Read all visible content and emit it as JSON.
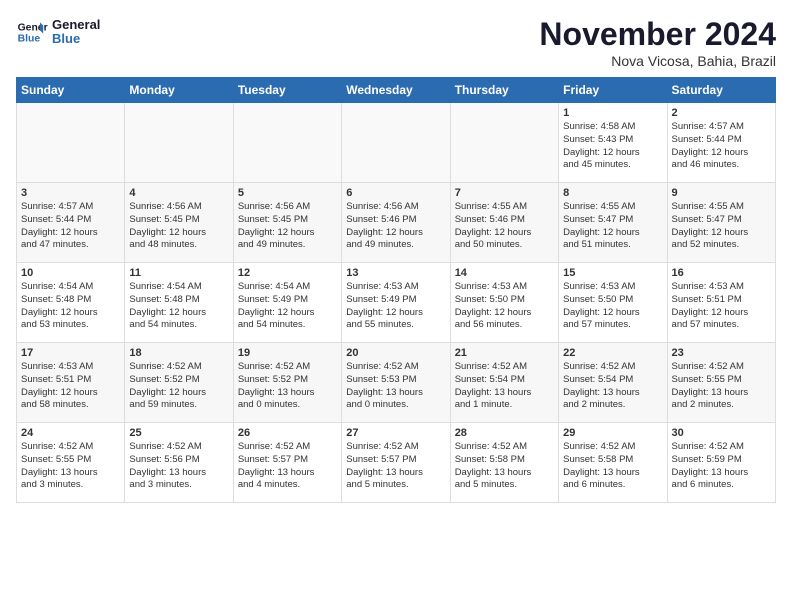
{
  "logo": {
    "line1": "General",
    "line2": "Blue"
  },
  "title": "November 2024",
  "location": "Nova Vicosa, Bahia, Brazil",
  "days_of_week": [
    "Sunday",
    "Monday",
    "Tuesday",
    "Wednesday",
    "Thursday",
    "Friday",
    "Saturday"
  ],
  "weeks": [
    [
      {
        "day": "",
        "info": ""
      },
      {
        "day": "",
        "info": ""
      },
      {
        "day": "",
        "info": ""
      },
      {
        "day": "",
        "info": ""
      },
      {
        "day": "",
        "info": ""
      },
      {
        "day": "1",
        "info": "Sunrise: 4:58 AM\nSunset: 5:43 PM\nDaylight: 12 hours\nand 45 minutes."
      },
      {
        "day": "2",
        "info": "Sunrise: 4:57 AM\nSunset: 5:44 PM\nDaylight: 12 hours\nand 46 minutes."
      }
    ],
    [
      {
        "day": "3",
        "info": "Sunrise: 4:57 AM\nSunset: 5:44 PM\nDaylight: 12 hours\nand 47 minutes."
      },
      {
        "day": "4",
        "info": "Sunrise: 4:56 AM\nSunset: 5:45 PM\nDaylight: 12 hours\nand 48 minutes."
      },
      {
        "day": "5",
        "info": "Sunrise: 4:56 AM\nSunset: 5:45 PM\nDaylight: 12 hours\nand 49 minutes."
      },
      {
        "day": "6",
        "info": "Sunrise: 4:56 AM\nSunset: 5:46 PM\nDaylight: 12 hours\nand 49 minutes."
      },
      {
        "day": "7",
        "info": "Sunrise: 4:55 AM\nSunset: 5:46 PM\nDaylight: 12 hours\nand 50 minutes."
      },
      {
        "day": "8",
        "info": "Sunrise: 4:55 AM\nSunset: 5:47 PM\nDaylight: 12 hours\nand 51 minutes."
      },
      {
        "day": "9",
        "info": "Sunrise: 4:55 AM\nSunset: 5:47 PM\nDaylight: 12 hours\nand 52 minutes."
      }
    ],
    [
      {
        "day": "10",
        "info": "Sunrise: 4:54 AM\nSunset: 5:48 PM\nDaylight: 12 hours\nand 53 minutes."
      },
      {
        "day": "11",
        "info": "Sunrise: 4:54 AM\nSunset: 5:48 PM\nDaylight: 12 hours\nand 54 minutes."
      },
      {
        "day": "12",
        "info": "Sunrise: 4:54 AM\nSunset: 5:49 PM\nDaylight: 12 hours\nand 54 minutes."
      },
      {
        "day": "13",
        "info": "Sunrise: 4:53 AM\nSunset: 5:49 PM\nDaylight: 12 hours\nand 55 minutes."
      },
      {
        "day": "14",
        "info": "Sunrise: 4:53 AM\nSunset: 5:50 PM\nDaylight: 12 hours\nand 56 minutes."
      },
      {
        "day": "15",
        "info": "Sunrise: 4:53 AM\nSunset: 5:50 PM\nDaylight: 12 hours\nand 57 minutes."
      },
      {
        "day": "16",
        "info": "Sunrise: 4:53 AM\nSunset: 5:51 PM\nDaylight: 12 hours\nand 57 minutes."
      }
    ],
    [
      {
        "day": "17",
        "info": "Sunrise: 4:53 AM\nSunset: 5:51 PM\nDaylight: 12 hours\nand 58 minutes."
      },
      {
        "day": "18",
        "info": "Sunrise: 4:52 AM\nSunset: 5:52 PM\nDaylight: 12 hours\nand 59 minutes."
      },
      {
        "day": "19",
        "info": "Sunrise: 4:52 AM\nSunset: 5:52 PM\nDaylight: 13 hours\nand 0 minutes."
      },
      {
        "day": "20",
        "info": "Sunrise: 4:52 AM\nSunset: 5:53 PM\nDaylight: 13 hours\nand 0 minutes."
      },
      {
        "day": "21",
        "info": "Sunrise: 4:52 AM\nSunset: 5:54 PM\nDaylight: 13 hours\nand 1 minute."
      },
      {
        "day": "22",
        "info": "Sunrise: 4:52 AM\nSunset: 5:54 PM\nDaylight: 13 hours\nand 2 minutes."
      },
      {
        "day": "23",
        "info": "Sunrise: 4:52 AM\nSunset: 5:55 PM\nDaylight: 13 hours\nand 2 minutes."
      }
    ],
    [
      {
        "day": "24",
        "info": "Sunrise: 4:52 AM\nSunset: 5:55 PM\nDaylight: 13 hours\nand 3 minutes."
      },
      {
        "day": "25",
        "info": "Sunrise: 4:52 AM\nSunset: 5:56 PM\nDaylight: 13 hours\nand 3 minutes."
      },
      {
        "day": "26",
        "info": "Sunrise: 4:52 AM\nSunset: 5:57 PM\nDaylight: 13 hours\nand 4 minutes."
      },
      {
        "day": "27",
        "info": "Sunrise: 4:52 AM\nSunset: 5:57 PM\nDaylight: 13 hours\nand 5 minutes."
      },
      {
        "day": "28",
        "info": "Sunrise: 4:52 AM\nSunset: 5:58 PM\nDaylight: 13 hours\nand 5 minutes."
      },
      {
        "day": "29",
        "info": "Sunrise: 4:52 AM\nSunset: 5:58 PM\nDaylight: 13 hours\nand 6 minutes."
      },
      {
        "day": "30",
        "info": "Sunrise: 4:52 AM\nSunset: 5:59 PM\nDaylight: 13 hours\nand 6 minutes."
      }
    ]
  ]
}
